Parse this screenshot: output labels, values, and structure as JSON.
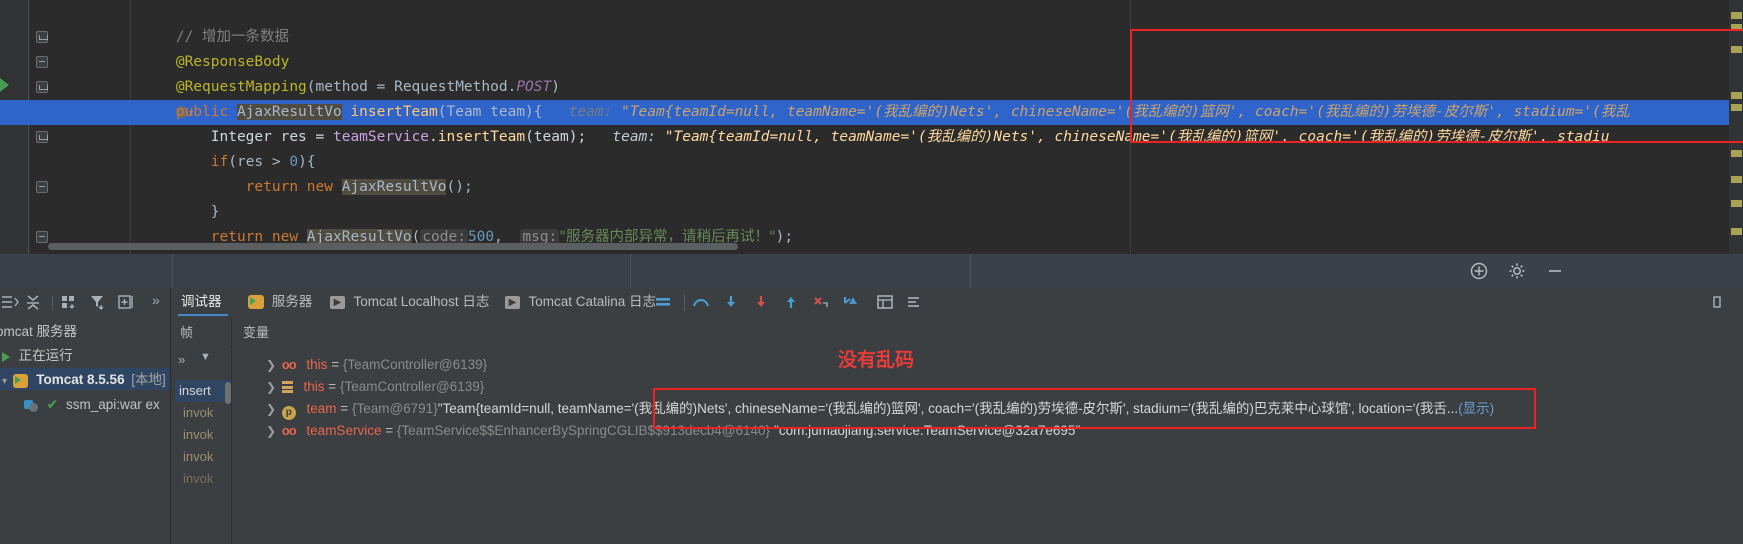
{
  "editor": {
    "lines": [
      {
        "indent": 0,
        "text": "// 增加一条数据",
        "kind": "comment"
      },
      {
        "indent": 0,
        "text": "@ResponseBody",
        "kind": "annotation"
      },
      {
        "indent": 0,
        "text": "@RequestMapping(method = RequestMethod.POST)",
        "kind": "annotation"
      },
      {
        "indent": 0,
        "text": "public AjaxResultVo insertTeam(Team team){",
        "kind": "code"
      },
      {
        "indent": 1,
        "text": "Integer res = teamService.insertTeam(team);",
        "kind": "code"
      },
      {
        "indent": 1,
        "text": "if(res > 0){",
        "kind": "code"
      },
      {
        "indent": 2,
        "text": "return new AjaxResultVo();",
        "kind": "code"
      },
      {
        "indent": 1,
        "text": "}",
        "kind": "code"
      },
      {
        "indent": 1,
        "text": "return new AjaxResultVo( code: 500,  msg: \"服务器内部异常，请稍后再试！\");",
        "kind": "code"
      },
      {
        "indent": 0,
        "text": "}",
        "kind": "code"
      }
    ],
    "inline_hint_label": "team:",
    "param_hint_code": "code:",
    "param_hint_msg": "msg:",
    "hint_value_line4": "\"Team{teamId=null, teamName='(我乱编的)Nets', chineseName='(我乱编的)篮网', coach='(我乱编的)劳埃德-皮尔斯', stadium='(我乱",
    "hint_value_line5": "\"Team{teamId=null, teamName='(我乱编的)Nets', chineseName='(我乱编的)篮网', coach='(我乱编的)劳埃德-皮尔斯', stadiu",
    "error_msg_string": "\"服务器内部异常，请稍后再试！\"",
    "code_value": "500",
    "highlighted_line_index": 4
  },
  "left_panel": {
    "toolbar_icons": [
      "expand-all-icon",
      "collapse-all-icon",
      "layout-icon",
      "filter-icon",
      "add-frame-icon",
      "more-icon"
    ],
    "tree": [
      {
        "label": "omcat 服务器",
        "level": 0,
        "selected": false
      },
      {
        "label": "正在运行",
        "level": 1,
        "selected": false,
        "icon": "run-icon"
      },
      {
        "label": "Tomcat 8.5.56",
        "suffix": "[本地]",
        "level": 1,
        "selected": true,
        "icon": "tomcat-icon"
      },
      {
        "label": "ssm_api:war ex",
        "level": 2,
        "selected": false,
        "icon": "artifact-icon"
      }
    ]
  },
  "tabs": {
    "items": [
      {
        "label": "调试器",
        "active": true,
        "icon": null
      },
      {
        "label": "服务器",
        "active": false,
        "icon": "tomcat-icon"
      },
      {
        "label": "Tomcat Localhost 日志",
        "active": false,
        "icon": "console-icon"
      },
      {
        "label": "Tomcat Catalina 日志",
        "active": false,
        "icon": "console-icon"
      }
    ],
    "toolbar_icons": [
      "console-toggle-icon",
      "step-over-icon",
      "step-into-icon",
      "force-step-into-icon",
      "step-out-icon",
      "drop-frame-icon",
      "run-to-cursor-icon",
      "evaluate-icon",
      "layout-icon"
    ]
  },
  "debugger": {
    "frames_header": "帧",
    "variables_header": "变量",
    "frames": [
      {
        "label": "insert",
        "selected": true
      },
      {
        "label": "invok",
        "selected": false
      },
      {
        "label": "invok",
        "selected": false
      },
      {
        "label": "invok",
        "selected": false
      },
      {
        "label": "invok",
        "selected": false
      }
    ],
    "variables": [
      {
        "icon": "oo-icon",
        "name": "this",
        "eq": " = ",
        "ref": "{TeamController@6139}",
        "value": ""
      },
      {
        "icon": "stack-icon",
        "name": "this",
        "eq": " = ",
        "ref": "{TeamController@6139}",
        "value": ""
      },
      {
        "icon": "p-icon",
        "name": "team",
        "eq": " = ",
        "ref": "{Team@6791}",
        "value": "\"Team{teamId=null, teamName='(我乱编的)Nets', chineseName='(我乱编的)篮网', coach='(我乱编的)劳埃德-皮尔斯', stadium='(我乱编的)巴克莱中心球馆', location='(我舌...",
        "more_link": "(显示)"
      },
      {
        "icon": "oo-icon",
        "name": "teamService",
        "eq": " = ",
        "ref": "{TeamService$$EnhancerBySpringCGLIB$$913decb4@6140}",
        "value": "\"com.jumaojiang.service.TeamService@32a7e695\""
      }
    ]
  },
  "annotations": {
    "note_text": "没有乱码",
    "note_color": "#e83b3b",
    "box_color": "#ee2222"
  },
  "colors": {
    "editor_bg": "#2b2b2b",
    "panel_bg": "#3c3f41",
    "selection_blue": "#2f65ca",
    "tab_accent": "#4a88c7",
    "tree_selection": "#2f4562"
  }
}
